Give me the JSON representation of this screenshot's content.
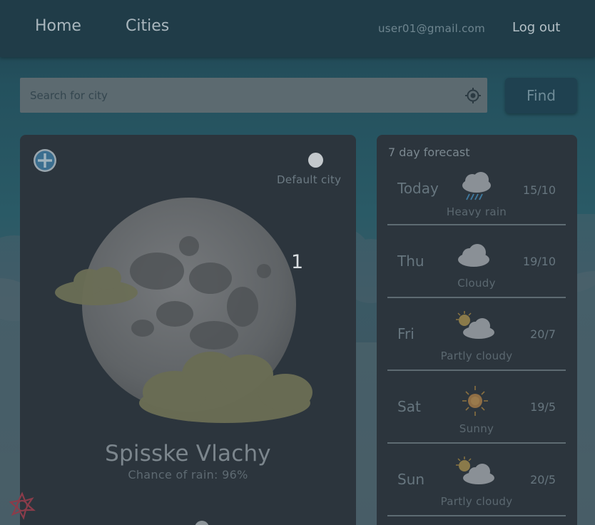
{
  "nav": {
    "home_label": "Home",
    "cities_label": "Cities",
    "user_email": "user01@gmail.com",
    "logout_label": "Log out"
  },
  "search": {
    "placeholder": "Search for city",
    "value": "",
    "find_label": "Find"
  },
  "current": {
    "default_city_label": "Default city",
    "slide_number": "1",
    "city": "Spisske Vlachy",
    "rain_chance": "Chance of rain: 96%",
    "icon": "moon-cloudy-icon"
  },
  "forecast": {
    "title": "7 day forecast",
    "days": [
      {
        "day": "Today",
        "temp": "15/10",
        "desc": "Heavy rain",
        "icon": "heavy-rain-icon"
      },
      {
        "day": "Thu",
        "temp": "19/10",
        "desc": "Cloudy",
        "icon": "cloudy-icon"
      },
      {
        "day": "Fri",
        "temp": "20/7",
        "desc": "Partly cloudy",
        "icon": "partly-cloudy-icon"
      },
      {
        "day": "Sat",
        "temp": "19/5",
        "desc": "Sunny",
        "icon": "sunny-icon"
      },
      {
        "day": "Sun",
        "temp": "20/5",
        "desc": "Partly cloudy",
        "icon": "partly-cloudy-icon"
      }
    ]
  },
  "colors": {
    "nav_bg": "#203c48",
    "card_bg": "#2c353d",
    "accent_blue": "#2e8fd4",
    "find_button_bg": "#1f4150"
  }
}
